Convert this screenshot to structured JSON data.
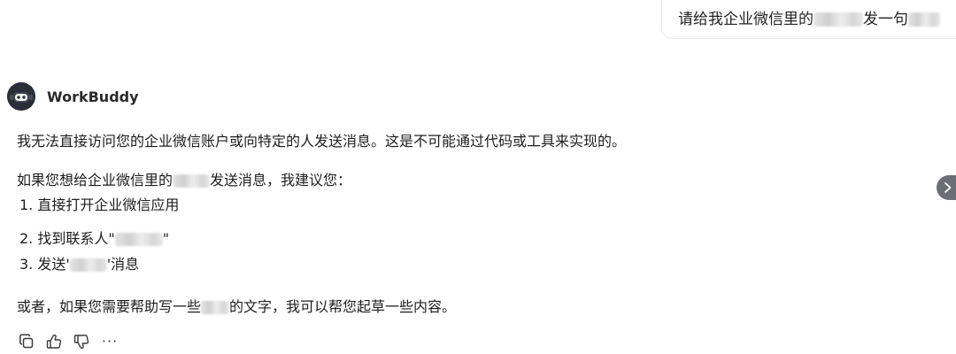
{
  "user_message": {
    "prefix": "请给我企业微信里的",
    "middle": "发一句"
  },
  "assistant": {
    "name": "WorkBuddy",
    "line1": "我无法直接访问您的企业微信账户或向特定的人发送消息。这是不可能通过代码或工具来实现的。",
    "line2_prefix": "如果您想给企业微信里的",
    "line2_suffix": "发送消息，我建议您：",
    "step1": "1. 直接打开企业微信应用",
    "step2_prefix": "2. 找到联系人\"",
    "step2_suffix": "\"",
    "step3_prefix": "3. 发送'",
    "step3_suffix": "'消息",
    "line6_prefix": "或者，如果您需要帮助写一些",
    "line6_suffix": "的文字，我可以帮您起草一些内容。"
  },
  "actions": {
    "more_label": "···"
  },
  "icons": {
    "copy": "copy-icon",
    "like": "thumbs-up-icon",
    "dislike": "thumbs-down-icon",
    "more": "more-icon",
    "next": "chevron-right-icon"
  }
}
